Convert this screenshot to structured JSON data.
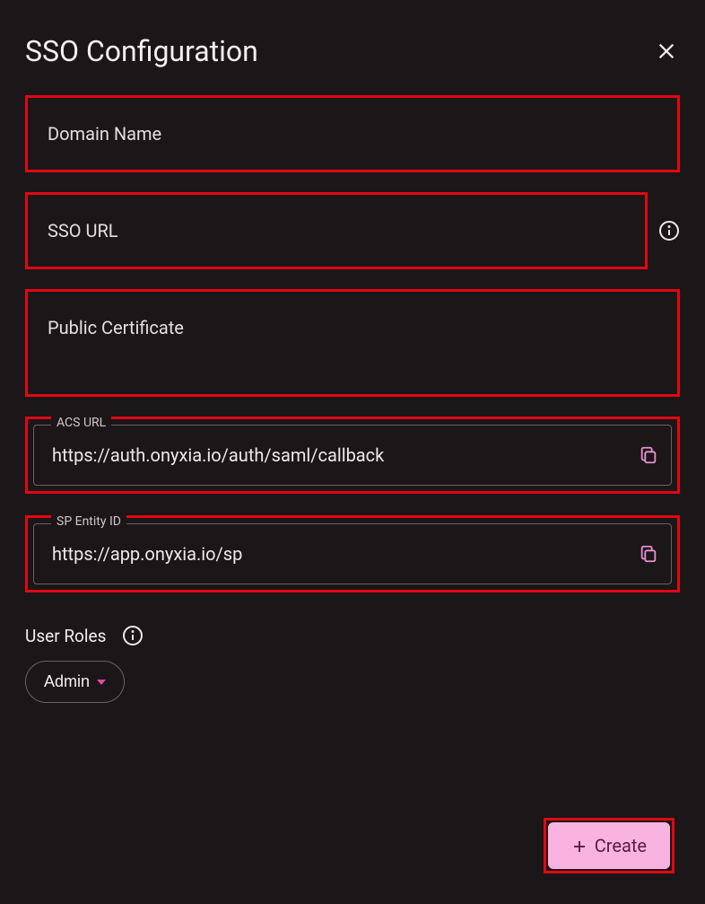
{
  "header": {
    "title": "SSO Configuration"
  },
  "fields": {
    "domain_name": {
      "placeholder": "Domain Name",
      "value": ""
    },
    "sso_url": {
      "placeholder": "SSO URL",
      "value": ""
    },
    "public_certificate": {
      "placeholder": "Public Certificate",
      "value": ""
    },
    "acs_url": {
      "label": "ACS URL",
      "value": "https://auth.onyxia.io/auth/saml/callback"
    },
    "sp_entity_id": {
      "label": "SP Entity ID",
      "value": "https://app.onyxia.io/sp"
    }
  },
  "roles": {
    "label": "User Roles",
    "selected": "Admin"
  },
  "footer": {
    "create_label": "Create"
  }
}
